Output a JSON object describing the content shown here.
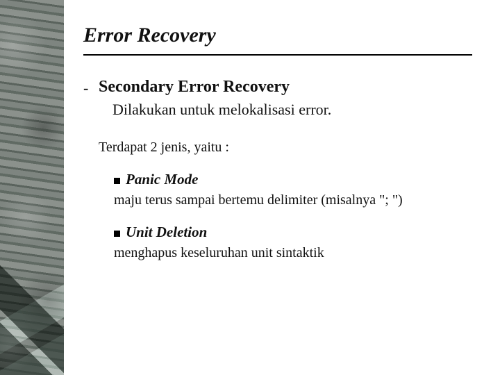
{
  "title": "Error Recovery",
  "item": {
    "dash": "-",
    "heading": "Secondary Error Recovery",
    "description": "Dilakukan untuk melokalisasi error."
  },
  "subintro": "Terdapat 2 jenis, yaitu :",
  "subs": [
    {
      "heading": "Panic Mode",
      "description": "maju terus sampai bertemu delimiter (misalnya \"; \")"
    },
    {
      "heading": "Unit Deletion",
      "description": "menghapus keseluruhan unit sintaktik"
    }
  ]
}
